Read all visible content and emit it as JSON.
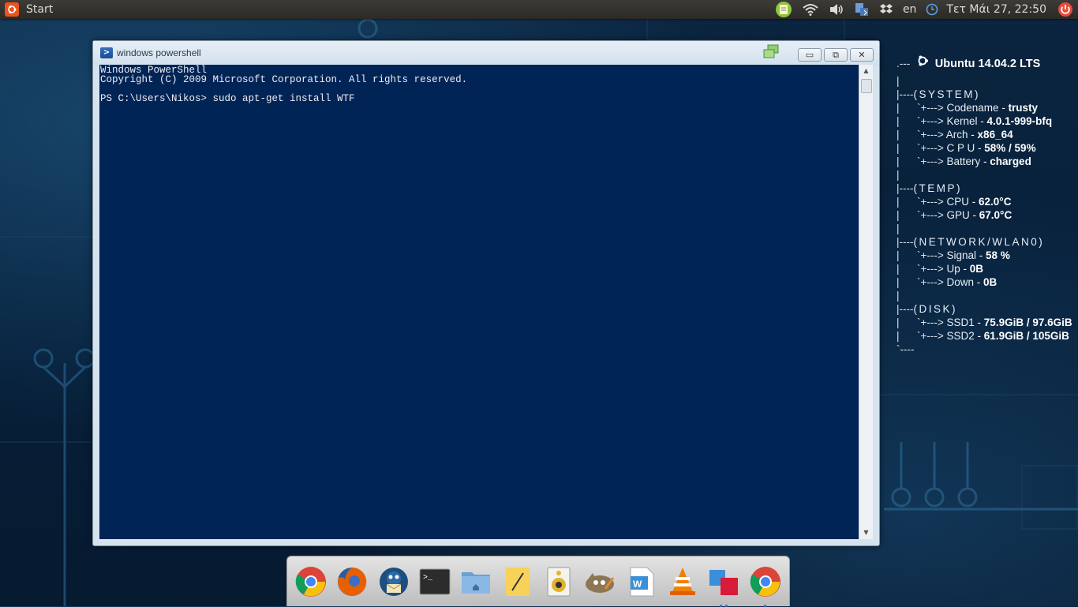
{
  "panel": {
    "start_label": "Start",
    "lang": "en",
    "clock": "Τετ Μάι 27, 22:50",
    "tray_icons": [
      "notes-icon",
      "wifi-icon",
      "volume-icon",
      "network-transfer-icon",
      "dropbox-icon",
      "keyboard-lang-indicator",
      "time-icon",
      "power-icon"
    ]
  },
  "conky": {
    "title": "Ubuntu 14.04.2 LTS",
    "sections": [
      {
        "name": "(SYSTEM)",
        "items": [
          {
            "key": "Codename",
            "value": "trusty"
          },
          {
            "key": "Kernel",
            "value": "4.0.1-999-bfq"
          },
          {
            "key": "Arch",
            "value": "x86_64"
          },
          {
            "key": "C P U",
            "value": "58% / 59%"
          },
          {
            "key": "Battery",
            "value": "charged"
          }
        ]
      },
      {
        "name": "(TEMP)",
        "items": [
          {
            "key": "CPU",
            "value": "62.0°C"
          },
          {
            "key": "GPU",
            "value": "67.0°C"
          }
        ]
      },
      {
        "name": "(NETWORK/WLAN0)",
        "items": [
          {
            "key": "Signal",
            "value": "58 %"
          },
          {
            "key": "Up",
            "value": "0B"
          },
          {
            "key": "Down",
            "value": "0B"
          }
        ]
      },
      {
        "name": "(DISK)",
        "items": [
          {
            "key": "SSD1",
            "value": "75.9GiB / 97.6GiB"
          },
          {
            "key": "SSD2",
            "value": "61.9GiB / 105GiB"
          }
        ]
      }
    ]
  },
  "window": {
    "title": "windows powershell",
    "buttons": {
      "minimize": "▭",
      "restore": "⧉",
      "close": "✕"
    },
    "console_lines": [
      "Windows PowerShell",
      "Copyright (C) 2009 Microsoft Corporation. All rights reserved.",
      "",
      "PS C:\\Users\\Nikos> sudo apt-get install WTF"
    ]
  },
  "dock": {
    "apps": [
      {
        "name": "chrome-icon"
      },
      {
        "name": "firefox-icon"
      },
      {
        "name": "thunderbird-icon"
      },
      {
        "name": "terminal-icon"
      },
      {
        "name": "files-icon"
      },
      {
        "name": "text-editor-icon"
      },
      {
        "name": "speaker-icon"
      },
      {
        "name": "gimp-icon"
      },
      {
        "name": "writer-icon"
      },
      {
        "name": "vlc-icon"
      },
      {
        "name": "app-icon"
      },
      {
        "name": "chrome-2-icon"
      }
    ],
    "terminal_prompt": ">_"
  },
  "colors": {
    "console_bg": "#012456",
    "ubuntu_orange": "#e95420"
  }
}
